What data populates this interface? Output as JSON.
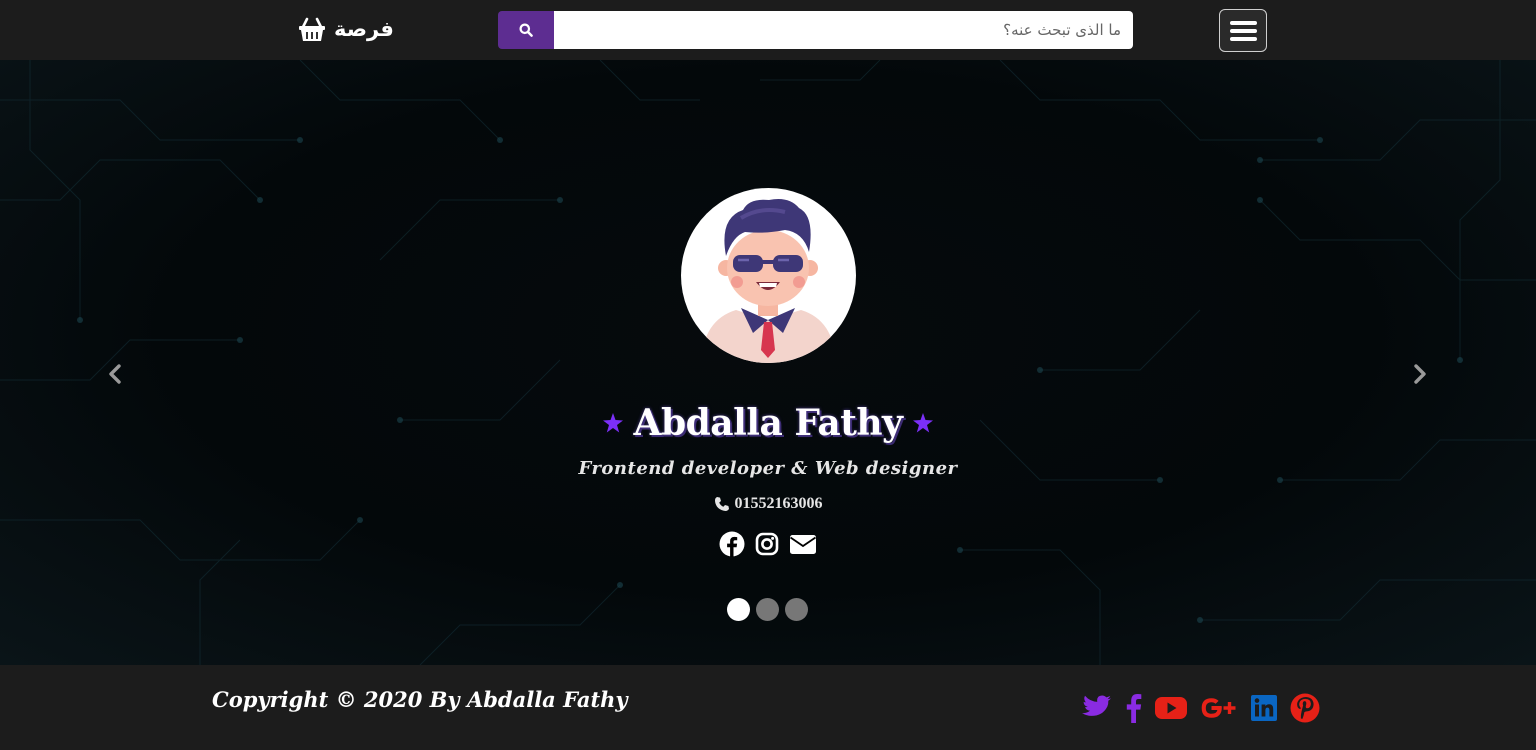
{
  "navbar": {
    "brand_text": "فرصة",
    "brand_icon": "shopping-basket-icon",
    "search_placeholder": "ما الذى تبحث عنه؟",
    "search_icon": "search-icon",
    "menu_icon": "hamburger-menu-icon",
    "accent_color": "#5d2d91"
  },
  "hero": {
    "avatar_icon": "avatar-illustration",
    "name": "Abdalla Fathy",
    "tagline": "Frontend developer & Web designer",
    "phone": "01552163006",
    "social_icons": [
      "facebook-icon",
      "instagram-icon",
      "envelope-icon"
    ],
    "carousel": {
      "slide_count": 3,
      "active_index": 0
    },
    "star_color": "#7b2ff7"
  },
  "footer": {
    "copyright": "Copyright © 2020 By Abdalla Fathy",
    "social_icons": [
      {
        "icon": "twitter-icon",
        "color": "#8a2be2"
      },
      {
        "icon": "facebook-icon",
        "color": "#8a2be2"
      },
      {
        "icon": "youtube-icon",
        "color": "#e62117"
      },
      {
        "icon": "google-plus-icon",
        "color": "#e62117"
      },
      {
        "icon": "linkedin-icon",
        "color": "#0a66c2"
      },
      {
        "icon": "pinterest-icon",
        "color": "#e62117"
      }
    ]
  }
}
